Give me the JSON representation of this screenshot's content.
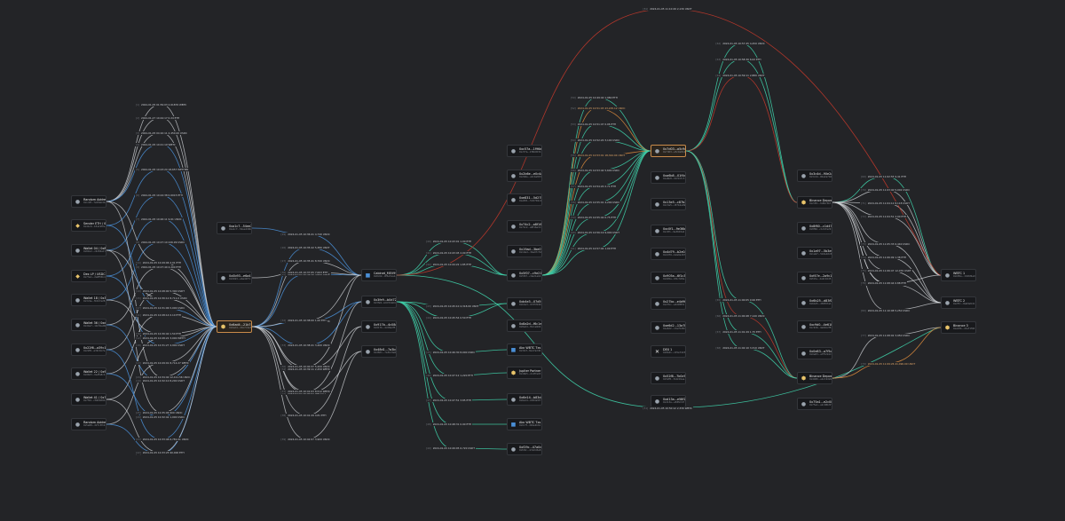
{
  "colors": {
    "bg": "#232427",
    "white": "#d7d9dd",
    "blue": "#4a8fd6",
    "teal": "#3fcfa8",
    "orange": "#d98a3d",
    "red": "#c0392b",
    "hub_border": "#c98b4a"
  },
  "nodes": [
    {
      "id": "n1",
      "name": "Random Address 01",
      "addr": "0x1d2f...7e09ab41c3f0",
      "icon": "circle",
      "col": "#9aa3ad"
    },
    {
      "id": "n2",
      "name": "Sender ETH / 0x4b",
      "addr": "0x4bc0...b3a19f2e",
      "icon": "coin",
      "col": "#e9c46a"
    },
    {
      "id": "n3",
      "name": "Wallet 04 / 0x81",
      "addr": "0x81b2...c6d04a17",
      "icon": "circle",
      "col": "#9aa3ad"
    },
    {
      "id": "n4",
      "name": "Dex LP / USDC",
      "addr": "0x73e1...2a8f55bd",
      "icon": "coin",
      "col": "#e9c46a"
    },
    {
      "id": "n5",
      "name": "Wallet 18 / 0x3c",
      "addr": "0x3c9e...f10b7a28",
      "icon": "circle",
      "col": "#9aa3ad"
    },
    {
      "id": "n6",
      "name": "Wallet 36 / 0xd4 tx",
      "addr": "0xd4a7...19c3be06",
      "icon": "circle",
      "col": "#9aa3ad"
    },
    {
      "id": "n7",
      "name": "0x22f6...a39c1b7e",
      "addr": "0x22f6...a39c1b7e",
      "icon": "circle",
      "col": "#9aa3ad"
    },
    {
      "id": "n8",
      "name": "Wallet 22 / 0x96",
      "addr": "0x96d3...0e4fa8c2",
      "icon": "circle",
      "col": "#9aa3ad"
    },
    {
      "id": "n9",
      "name": "Wallet 41 / 0x7f",
      "addr": "0x7f10...c82b9d64",
      "icon": "circle",
      "col": "#9aa3ad"
    },
    {
      "id": "n10",
      "name": "Random Address 02",
      "addr": "0x5e88...d27c3f19",
      "icon": "circle",
      "col": "#9aa3ad"
    },
    {
      "id": "n11",
      "name": "0xa1c7...54ee2d0b",
      "addr": "0xa1c7...54ee2d0b",
      "icon": "circle",
      "col": "#9aa3ad"
    },
    {
      "id": "n12",
      "name": "0x0b93...e6a41f7c",
      "addr": "0x0b93...e6a41f7c",
      "icon": "circle",
      "col": "#9aa3ad"
    },
    {
      "id": "n13",
      "name": "0x6ad4...21b7c9e3",
      "addr": "0x6ad4...21b7c9e3",
      "icon": "hex",
      "col": "#e9c46a"
    },
    {
      "id": "n14",
      "name": "Cabinet_MEV99",
      "addr": "0x8c02...9f3e51ab",
      "icon": "square",
      "col": "#4a8fd6"
    },
    {
      "id": "n15",
      "name": "0x3fe9...b0d72a64",
      "addr": "0x3fe9...b0d72a64",
      "icon": "circle",
      "col": "#9aa3ad"
    },
    {
      "id": "n16",
      "name": "0x917b...4c08e2f5",
      "addr": "0x917b...4c08e2f5",
      "icon": "circle",
      "col": "#9aa3ad"
    },
    {
      "id": "n17",
      "name": "0x48d1...7a3bc9e0",
      "addr": "0x48d1...7a3bc9e0",
      "icon": "circle",
      "col": "#9aa3ad"
    },
    {
      "id": "n18",
      "name": "0xc57a...1f96d03b",
      "addr": "0xc57a...1f96d03b",
      "icon": "circle",
      "col": "#9aa3ad"
    },
    {
      "id": "n19",
      "name": "0x2b6e...e0c4a815",
      "addr": "0x2b6e...e0c4a815",
      "icon": "circle",
      "col": "#9aa3ad"
    },
    {
      "id": "n20",
      "name": "0xe831...5d27b9c4",
      "addr": "0xe831...5d27b9c4",
      "icon": "circle",
      "col": "#9aa3ad"
    },
    {
      "id": "n21",
      "name": "0x74c2...a8f16e3d",
      "addr": "0x74c2...a8f16e3d",
      "icon": "circle",
      "col": "#9aa3ad"
    },
    {
      "id": "n22",
      "name": "0x19ad...3be07c52",
      "addr": "0x19ad...3be07c52",
      "icon": "circle",
      "col": "#9aa3ad"
    },
    {
      "id": "n23",
      "name": "0x5f07...c9e21ab4",
      "addr": "0x5f07...c9e21ab4",
      "icon": "circle",
      "col": "#9aa3ad"
    },
    {
      "id": "n24",
      "name": "0xb4e3...07d5f196",
      "addr": "0xb4e3...07d5f196",
      "icon": "circle",
      "col": "#9aa3ad"
    },
    {
      "id": "n25",
      "name": "0x8a2d...f6c1e904",
      "addr": "0x8a2d...f6c1e904",
      "icon": "circle",
      "col": "#9aa3ad"
    },
    {
      "id": "n26",
      "name": "Abc WBTC Txs Payment_WTxybz",
      "addr": "0x30cf...8e17a2d9",
      "icon": "square",
      "col": "#4a8fd6"
    },
    {
      "id": "n27",
      "name": "Jupiter Partner Rebate Txs",
      "addr": "0xd9b5...2c4f7e03",
      "icon": "hex",
      "col": "#e9c46a"
    },
    {
      "id": "n28",
      "name": "0x6e14...b83da5f7",
      "addr": "0x6e14...b83da5f7",
      "icon": "circle",
      "col": "#9aa3ad"
    },
    {
      "id": "n29",
      "name": "Abc WBTC Txs Payment_WTxybz",
      "addr": "0x0c7f...d94e2b61",
      "icon": "square",
      "col": "#4a8fd6"
    },
    {
      "id": "n30",
      "name": "0xf29c...47a0d3e8",
      "addr": "0xf29c...47a0d3e8",
      "icon": "circle",
      "col": "#9aa3ad"
    },
    {
      "id": "n31",
      "name": "0x7d03...a5c9e814",
      "addr": "0x7d03...a5c9e814",
      "icon": "circle",
      "col": "#9aa3ad"
    },
    {
      "id": "n32",
      "name": "0xa6b8...01f4d7c3",
      "addr": "0xa6b8...01f4d7c3",
      "icon": "circle",
      "col": "#9aa3ad"
    },
    {
      "id": "n33",
      "name": "0x13e5...c87b2a09",
      "addr": "0x13e5...c87b2a09",
      "icon": "circle",
      "col": "#9aa3ad"
    },
    {
      "id": "n34",
      "name": "0xc0f1...9e36b5a2",
      "addr": "0xc0f1...9e36b5a2",
      "icon": "circle",
      "col": "#9aa3ad"
    },
    {
      "id": "n35",
      "name": "0x4d79...b2e0a16f",
      "addr": "0x4d79...b2e0a16f",
      "icon": "circle",
      "col": "#9aa3ad"
    },
    {
      "id": "n36",
      "name": "0x905a...6f1c3d8e",
      "addr": "0x905a...6f1c3d8e",
      "icon": "circle",
      "col": "#9aa3ad"
    },
    {
      "id": "n37",
      "name": "0x27bc...e4d9f051",
      "addr": "0x27bc...e4d9f051",
      "icon": "circle",
      "col": "#9aa3ad"
    },
    {
      "id": "n38",
      "name": "0xe6d2...13a7b48c",
      "addr": "0xe6d2...13a7b48c",
      "icon": "circle",
      "col": "#9aa3ad"
    },
    {
      "id": "n39",
      "name": "DEX 1",
      "addr": "0x8b41...c05e7d23",
      "icon": "x",
      "col": "#e6e6e6"
    },
    {
      "id": "n40",
      "name": "0x52f8...7b0c91ea",
      "addr": "0x52f8...7b0c91ea",
      "icon": "circle",
      "col": "#9aa3ad"
    },
    {
      "id": "n41",
      "name": "0xd13a...e58f2c07",
      "addr": "0xd13a...e58f2c07",
      "icon": "circle",
      "col": "#9aa3ad"
    },
    {
      "id": "n42",
      "name": "0x3c4d...90e2a7b6",
      "addr": "0x3c4d...90e2a7b6",
      "icon": "circle",
      "col": "#9aa3ad"
    },
    {
      "id": "n43",
      "name": "Binance Deposit 2d51fa",
      "addr": "0x2d51...fa80c3b7",
      "icon": "hex",
      "col": "#e9c46a"
    },
    {
      "id": "n44",
      "name": "0x8f60...c1d47e29",
      "addr": "0x8f60...c1d47e29",
      "icon": "circle",
      "col": "#9aa3ad"
    },
    {
      "id": "n45",
      "name": "0x1a97...5b3e0dc8",
      "addr": "0x1a97...5b3e0dc8",
      "icon": "circle",
      "col": "#9aa3ad"
    },
    {
      "id": "n46",
      "name": "0xf47e...2a9c16d5",
      "addr": "0xf47e...2a9c16d5",
      "icon": "circle",
      "col": "#9aa3ad"
    },
    {
      "id": "n47",
      "name": "0x6b25...d83f07a1",
      "addr": "0x6b25...d83f07a1",
      "icon": "circle",
      "col": "#9aa3ad"
    },
    {
      "id": "n48",
      "name": "0xc9d0...4e61b2f8",
      "addr": "0xc9d0...4e61b2f8",
      "icon": "circle",
      "col": "#9aa3ad"
    },
    {
      "id": "n49",
      "name": "0x0e83...a7f5c94d",
      "addr": "0x0e83...a7f5c94d",
      "icon": "circle",
      "col": "#9aa3ad"
    },
    {
      "id": "n50",
      "name": "Binance Deposit 4480ebc",
      "addr": "0x4480...ebc19d26",
      "icon": "hex",
      "col": "#e9c46a"
    },
    {
      "id": "n51",
      "name": "0x75a1...e2c08b3f",
      "addr": "0x75a1...e2c08b3f",
      "icon": "circle",
      "col": "#9aa3ad"
    },
    {
      "id": "n52",
      "name": "WBTC 1",
      "addr": "0xb85e...13d6f4a0",
      "icon": "circle",
      "col": "#9aa3ad"
    },
    {
      "id": "n53",
      "name": "WBTC 2",
      "addr": "0x2f7c...8a09e5d1",
      "icon": "circle",
      "col": "#9aa3ad"
    },
    {
      "id": "n54",
      "name": "Binance 3",
      "addr": "0xe03b...c6a71f94",
      "icon": "hex",
      "col": "#e9c46a"
    }
  ],
  "edges": [
    {
      "idx": "[1]",
      "label": "2024-01-05 01:59:03 2.61876 WBTC",
      "tone": "w"
    },
    {
      "idx": "[2]",
      "label": "2024-01-27 10:44:17 0.24 ETH",
      "tone": "w"
    },
    {
      "idx": "[3]",
      "label": "2024-01-05 04:10:11 2,450.00 USDC",
      "tone": "w"
    },
    {
      "idx": "[4]",
      "label": "2024-01-05 10:21:19 WBTC",
      "tone": "b"
    },
    {
      "idx": "[5]",
      "label": "2024-01-05 10:23:24 18,657 WETHER",
      "tone": "b"
    },
    {
      "idx": "[6]",
      "label": "2024-01-05 10:24:38 0.6015 ETH",
      "tone": "b"
    },
    {
      "idx": "[7]",
      "label": "2024-01-05 10:26:11 9.61 USDC",
      "tone": "b"
    },
    {
      "idx": "[8]",
      "label": "2024-01-05 10:27:10 226.99 USDC",
      "tone": "b"
    },
    {
      "idx": "[9]",
      "label": "2024-01-05 10:27:40 4,200 ETH",
      "tone": "w"
    },
    {
      "idx": "[10]",
      "label": "2024-01-05 10:28:00 5,300 USDT",
      "tone": "w"
    },
    {
      "idx": "[11]",
      "label": "2024-01-05 10:28:14 0.10 ETH",
      "tone": "w"
    },
    {
      "idx": "[12]",
      "label": "2024-01-05 10:28:22 3,000 WETH",
      "tone": "w"
    },
    {
      "idx": "[13]",
      "label": "2024-01-05 10:29:01 8,714.27 WBTC",
      "tone": "w"
    },
    {
      "idx": "[14]",
      "label": "2024-01-05 10:29:06 4.01 ETH",
      "tone": "w"
    },
    {
      "idx": "[15]",
      "label": "2024-01-05 10:30:12 8,711.0 USDC",
      "tone": "w"
    },
    {
      "idx": "[16]",
      "label": "2024-01-05 10:30:40 1.50 ETH",
      "tone": "w"
    },
    {
      "idx": "[17]",
      "label": "2024-01-05 10:31:06 5,000 USDC",
      "tone": "b"
    },
    {
      "idx": "[18]",
      "label": "2024-01-05 10:31:27 4,900 USDT",
      "tone": "b"
    },
    {
      "idx": "[19]",
      "label": "2024-01-05 10:32:10 8,200 USDT",
      "tone": "b"
    },
    {
      "idx": "[20]",
      "label": "2024-01-05 10:32:42 1,000 USDC",
      "tone": "b"
    },
    {
      "idx": "[21]",
      "label": "2024-01-05 10:33:04 7,300 USDC",
      "tone": "b"
    },
    {
      "idx": "[22]",
      "label": "2024-01-05 10:33:25 90,000 ETH",
      "tone": "w"
    },
    {
      "idx": "[23]",
      "label": "2024-01-05 10:33:48 6,781.01 USDC",
      "tone": "b"
    },
    {
      "idx": "[24]",
      "label": "2024-01-05 10:34:40 12,411.56 USDC",
      "tone": "w"
    },
    {
      "idx": "[25]",
      "label": "2024-01-05 10:35:06 900 USDC",
      "tone": "w"
    },
    {
      "idx": "[26]",
      "label": "2024-01-05 10:35:22 5,380 USDT",
      "tone": "b"
    },
    {
      "idx": "[27]",
      "label": "2024-01-05 10:35:41 8,700 USDC",
      "tone": "w"
    },
    {
      "idx": "[28]",
      "label": "2024-01-05 10:36:10 3,600 USDC",
      "tone": "b"
    },
    {
      "idx": "[29]",
      "label": "2024-01-05 10:36:41 4,740 USDC",
      "tone": "b"
    },
    {
      "idx": "[30]",
      "label": "2024-01-05 10:37:05 7,003 ETH",
      "tone": "w"
    },
    {
      "idx": "[31]",
      "label": "2024-01-05 10:37:34 8,100 WBTC",
      "tone": "b"
    },
    {
      "idx": "[32]",
      "label": "2024-01-05 10:38:00 1.00 ETH",
      "tone": "w"
    },
    {
      "idx": "[33]",
      "label": "2024-01-05 10:38:41 3,400 USDC",
      "tone": "b"
    },
    {
      "idx": "[34]",
      "label": "2024-01-05 10:39:11 2,450 WBTC",
      "tone": "w"
    },
    {
      "idx": "[35]",
      "label": "2024-01-05 10:40:01 486 ETH",
      "tone": "w"
    },
    {
      "idx": "[36]",
      "label": "2024-01-05 10:40:37 5,200 USDC",
      "tone": "w"
    },
    {
      "idx": "[37]",
      "label": "2024-01-05 10:41:03 8,512 WBTC",
      "tone": "w"
    },
    {
      "idx": "[38]",
      "label": "2024-01-05 10:41:29 4.81 ETH",
      "tone": "w"
    },
    {
      "idx": "[39]",
      "label": "2024-01-05 10:42:07 3,900 USDC",
      "tone": "w"
    },
    {
      "idx": "[40]",
      "label": "2024-01-05 10:43:01 1.00 ETH",
      "tone": "t"
    },
    {
      "idx": "[41]",
      "label": "2024-01-05 10:43:45 2.00 ETH",
      "tone": "t"
    },
    {
      "idx": "[42]",
      "label": "2024-01-05 10:44:22 1.85 ETH",
      "tone": "t"
    },
    {
      "idx": "[43]",
      "label": "2024-01-05 10:45:10 4,318.00 USDT",
      "tone": "t"
    },
    {
      "idx": "[44]",
      "label": "2024-01-05 10:45:54 0.50 ETH",
      "tone": "t"
    },
    {
      "idx": "[45]",
      "label": "2024-01-05 10:46:30 8,000 USDC",
      "tone": "t"
    },
    {
      "idx": "[46]",
      "label": "2024-01-05 10:47:12 1,220 ETH",
      "tone": "t"
    },
    {
      "idx": "[47]",
      "label": "2024-01-05 10:47:51 3.85 ETH",
      "tone": "t"
    },
    {
      "idx": "[48]",
      "label": "2024-01-05 10:48:31 0.90 ETH",
      "tone": "t"
    },
    {
      "idx": "[49]",
      "label": "2024-01-05 10:49:05 6,720 USDT",
      "tone": "t"
    },
    {
      "idx": "[50]",
      "label": "2024-01-05 10:49:40 1,980 ETH",
      "tone": "t"
    },
    {
      "idx": "[51]",
      "label": "2024-01-05 10:50:12 2,330 WBTC",
      "tone": "t"
    },
    {
      "idx": "[52]",
      "label": "2024-01-05 10:51:03 43,205.12 USDC",
      "tone": "o"
    },
    {
      "idx": "[53]",
      "label": "2024-01-05 10:51:47 0.06 ETH",
      "tone": "t"
    },
    {
      "idx": "[54]",
      "label": "2024-01-05 10:52:20 3,100 USDC",
      "tone": "t"
    },
    {
      "idx": "[55]",
      "label": "2024-01-05 10:53:01 18,342.04 USDT",
      "tone": "o"
    },
    {
      "idx": "[56]",
      "label": "2024-01-05 10:53:44 5,600 USDC",
      "tone": "t"
    },
    {
      "idx": "[57]",
      "label": "2024-01-05 10:54:20 2.71 ETH",
      "tone": "t"
    },
    {
      "idx": "[58]",
      "label": "2024-01-05 10:55:01 4,200 USDC",
      "tone": "t"
    },
    {
      "idx": "[59]",
      "label": "2024-01-05 10:55:40 0.75 ETH",
      "tone": "t"
    },
    {
      "idx": "[60]",
      "label": "2024-01-05 10:56:19 9,900 USDT",
      "tone": "t"
    },
    {
      "idx": "[61]",
      "label": "2024-01-05 10:57:04 1.09 ETH",
      "tone": "t"
    },
    {
      "idx": "[62]",
      "label": "2024-01-05 10:57:45 4,450 USDC",
      "tone": "t"
    },
    {
      "idx": "[63]",
      "label": "2024-01-05 10:58:30 6.02 ETH",
      "tone": "t"
    },
    {
      "idx": "[64]",
      "label": "2024-01-05 10:59:11 2,880 USDT",
      "tone": "r"
    },
    {
      "idx": "[65]",
      "label": "2024-01-05 11:00:05 0.99 ETH",
      "tone": "t"
    },
    {
      "idx": "[66]",
      "label": "2024-01-05 11:00:48 7,140 USDC",
      "tone": "r"
    },
    {
      "idx": "[67]",
      "label": "2024-01-05 11:01:29 1.75 ETH",
      "tone": "t"
    },
    {
      "idx": "[68]",
      "label": "2024-01-05 11:02:10 3,310 USDT",
      "tone": "t"
    },
    {
      "idx": "[69]",
      "label": "2024-01-05 11:02:55 9.41 ETH",
      "tone": "t"
    },
    {
      "idx": "[70]",
      "label": "2024-01-05 11:03:40 5,002 USDC",
      "tone": "w"
    },
    {
      "idx": "[71]",
      "label": "2024-01-05 11:04:12 8,118 USDT",
      "tone": "w"
    },
    {
      "idx": "[72]",
      "label": "2024-01-05 11:04:51 2.00 ETH",
      "tone": "w"
    },
    {
      "idx": "[73]",
      "label": "2024-01-05 11:05:33 6,440 USDC",
      "tone": "w"
    },
    {
      "idx": "[74]",
      "label": "2024-01-05 11:06:09 1.38 ETH",
      "tone": "w"
    },
    {
      "idx": "[75]",
      "label": "2024-01-05 11:06:47 12,070 USDT",
      "tone": "w"
    },
    {
      "idx": "[76]",
      "label": "2024-01-05 11:07:28 4.44 ETH",
      "tone": "w"
    },
    {
      "idx": "[77]",
      "label": "2024-01-05 11:08:02 3,950 USDC",
      "tone": "w"
    },
    {
      "idx": "[78]",
      "label": "2024-01-05 11:08:44 0.88 ETH",
      "tone": "w"
    },
    {
      "idx": "[79]",
      "label": "2024-01-05 11:09:26 41,090.00 USDT",
      "tone": "o"
    },
    {
      "idx": "[80]",
      "label": "2024-01-05 11:10:08 5,250 USDC",
      "tone": "w"
    },
    {
      "idx": "[81]",
      "label": "2024-01-05 11:10:49 2,130 USDT",
      "tone": "r"
    },
    {
      "idx": "[82]",
      "label": "2024-01-05 11:11:31 1.20 ETH",
      "tone": "w"
    },
    {
      "idx": "[83]",
      "label": "2024-01-05 11:12:13 24,008.41 ETH",
      "tone": "t"
    }
  ]
}
